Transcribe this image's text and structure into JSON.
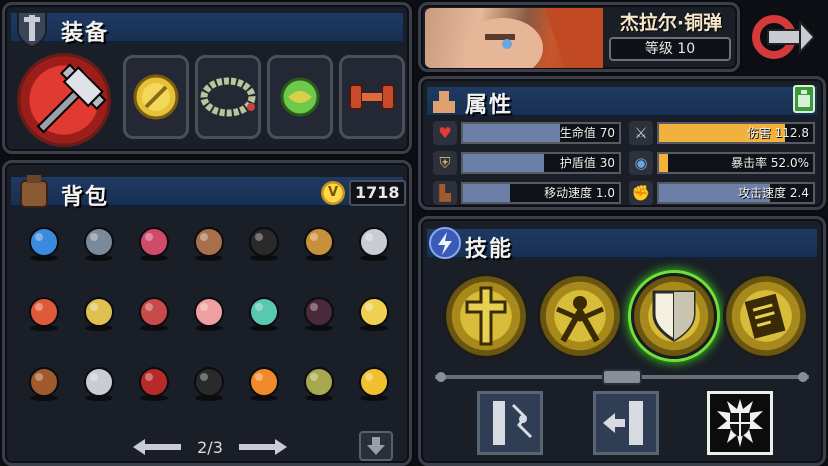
{
  "equipment": {
    "title": "装备",
    "weapon_icon": "hammer-icon",
    "slots": [
      {
        "icon": "gold-sword-coin-icon"
      },
      {
        "icon": "bead-necklace-icon"
      },
      {
        "icon": "green-orb-icon"
      },
      {
        "icon": "red-dumbbell-icon"
      }
    ]
  },
  "hero": {
    "name": "杰拉尔·铜弹",
    "level": "等级 10"
  },
  "attributes": {
    "title": "属性",
    "stats": [
      {
        "label": "生命值 70",
        "icon": "heart-icon",
        "fill": 0.62,
        "color": "#6c7fa6"
      },
      {
        "label": "伤害 112.8",
        "icon": "sword-icon",
        "fill": 0.82,
        "color": "#f2b13c"
      },
      {
        "label": "护盾值 30",
        "icon": "shield-icon",
        "fill": 0.52,
        "color": "#6c7fa6"
      },
      {
        "label": "暴击率 52.0%",
        "icon": "eye-icon",
        "fill": 0.06,
        "color": "#f2b13c"
      },
      {
        "label": "移动速度 1.0",
        "icon": "boot-icon",
        "fill": 0.3,
        "color": "#6c7fa6"
      },
      {
        "label": "攻击速度 2.4",
        "icon": "fist-icon",
        "fill": 0.72,
        "color": "#6c7fa6"
      }
    ]
  },
  "backpack": {
    "title": "背包",
    "gold": "1718",
    "page": "2/3",
    "items": [
      "spellbook-icon",
      "compass-icon",
      "ring-icon",
      "rope-icon",
      "shadow-beast-icon",
      "goggles-icon",
      "knight-helmet-icon",
      "hourglass-icon",
      "shield-egg-icon",
      "demon-mask-icon",
      "sundae-icon",
      "elf-head-icon",
      "bat-wings-icon",
      "fairy-icon",
      "winged-boot-icon",
      "wolf-head-icon",
      "red-spider-icon",
      "skull-bomb-icon",
      "fire-bell-icon",
      "spiky-pod-icon",
      "gold-armor-icon"
    ]
  },
  "skills": {
    "title": "技能",
    "active": [
      {
        "icon": "cross-icon"
      },
      {
        "icon": "warrior-icon"
      },
      {
        "icon": "shield-skill-icon",
        "selected": true
      },
      {
        "icon": "scroll-icon"
      }
    ],
    "passives": [
      {
        "icon": "crack-bar-icon"
      },
      {
        "icon": "bar-arrow-icon"
      },
      {
        "icon": "shield-burst-icon",
        "selected": true
      }
    ]
  }
}
